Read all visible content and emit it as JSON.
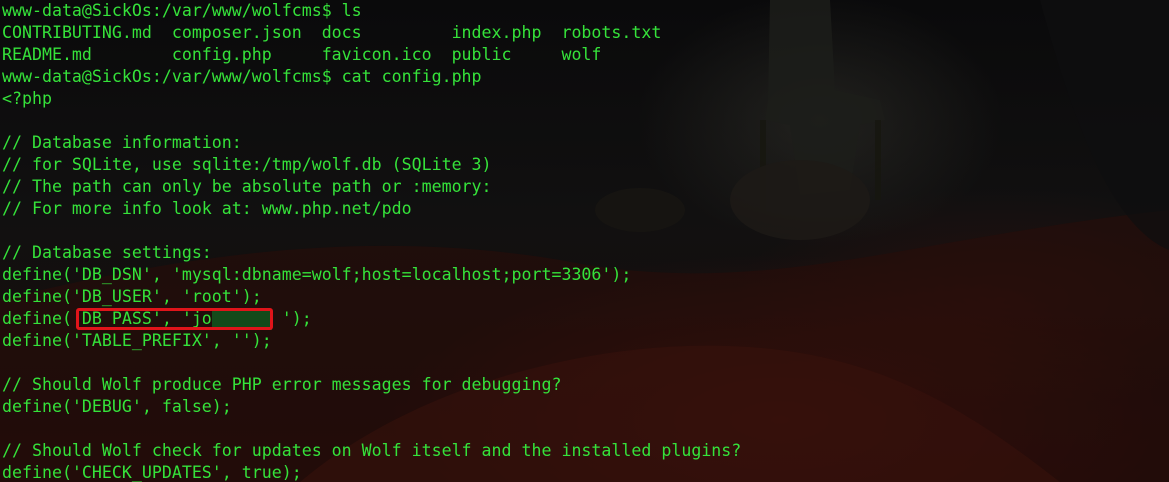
{
  "terminal": {
    "lines": [
      "www-data@SickOs:/var/www/wolfcms$ ls",
      "CONTRIBUTING.md  composer.json  docs         index.php  robots.txt",
      "README.md        config.php     favicon.ico  public     wolf",
      "www-data@SickOs:/var/www/wolfcms$ cat config.php",
      "<?php",
      "",
      "// Database information:",
      "// for SQLite, use sqlite:/tmp/wolf.db (SQLite 3)",
      "// The path can only be absolute path or :memory:",
      "// For more info look at: www.php.net/pdo",
      "",
      "// Database settings:",
      "define('DB_DSN', 'mysql:dbname=wolf;host=localhost;port=3306');",
      "define('DB_USER', 'root');",
      "define('DB_PASS', 'jo       ');",
      "define('TABLE_PREFIX', '');",
      "",
      "// Should Wolf produce PHP error messages for debugging?",
      "define('DEBUG', false);",
      "",
      "// Should Wolf check for updates on Wolf itself and the installed plugins?",
      "define('CHECK_UPDATES', true);"
    ]
  },
  "colors": {
    "text": "#35e23a",
    "background": "#0b0b0c",
    "highlight_border": "#e0141a",
    "redaction": "#144a1a"
  }
}
